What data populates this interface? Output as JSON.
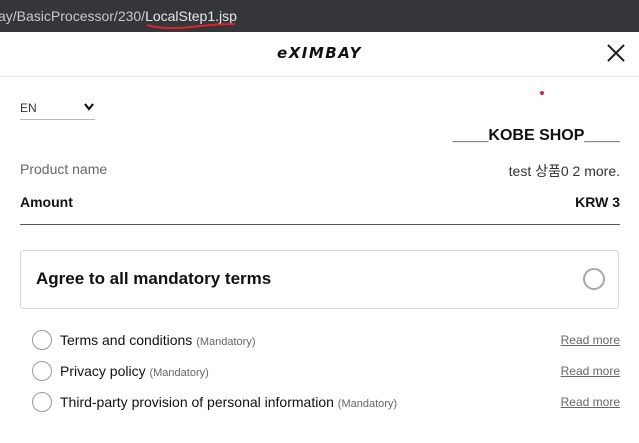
{
  "browser": {
    "url_prefix": "ay/BasicProcessor/230/",
    "url_page": "LocalStep1.jsp",
    "annotation_color": "#d9232e"
  },
  "header": {
    "logo": "eXIMBAY",
    "close_icon": "close-icon"
  },
  "language": {
    "selected": "EN",
    "chevron_icon": "chevron-down-icon"
  },
  "shop": {
    "name": "____KOBE SHOP____"
  },
  "order": {
    "product_label": "Product name",
    "product_value": "test 상품0 2 more.",
    "amount_label": "Amount",
    "amount_value": "KRW 3"
  },
  "agreement": {
    "all_label": "Agree to all mandatory terms",
    "terms": [
      {
        "label": "Terms and conditions",
        "tag": "(Mandatory)",
        "link": "Read more"
      },
      {
        "label": "Privacy policy",
        "tag": "(Mandatory)",
        "link": "Read more"
      },
      {
        "label": "Third-party provision of personal information",
        "tag": "(Mandatory)",
        "link": "Read more"
      }
    ]
  }
}
